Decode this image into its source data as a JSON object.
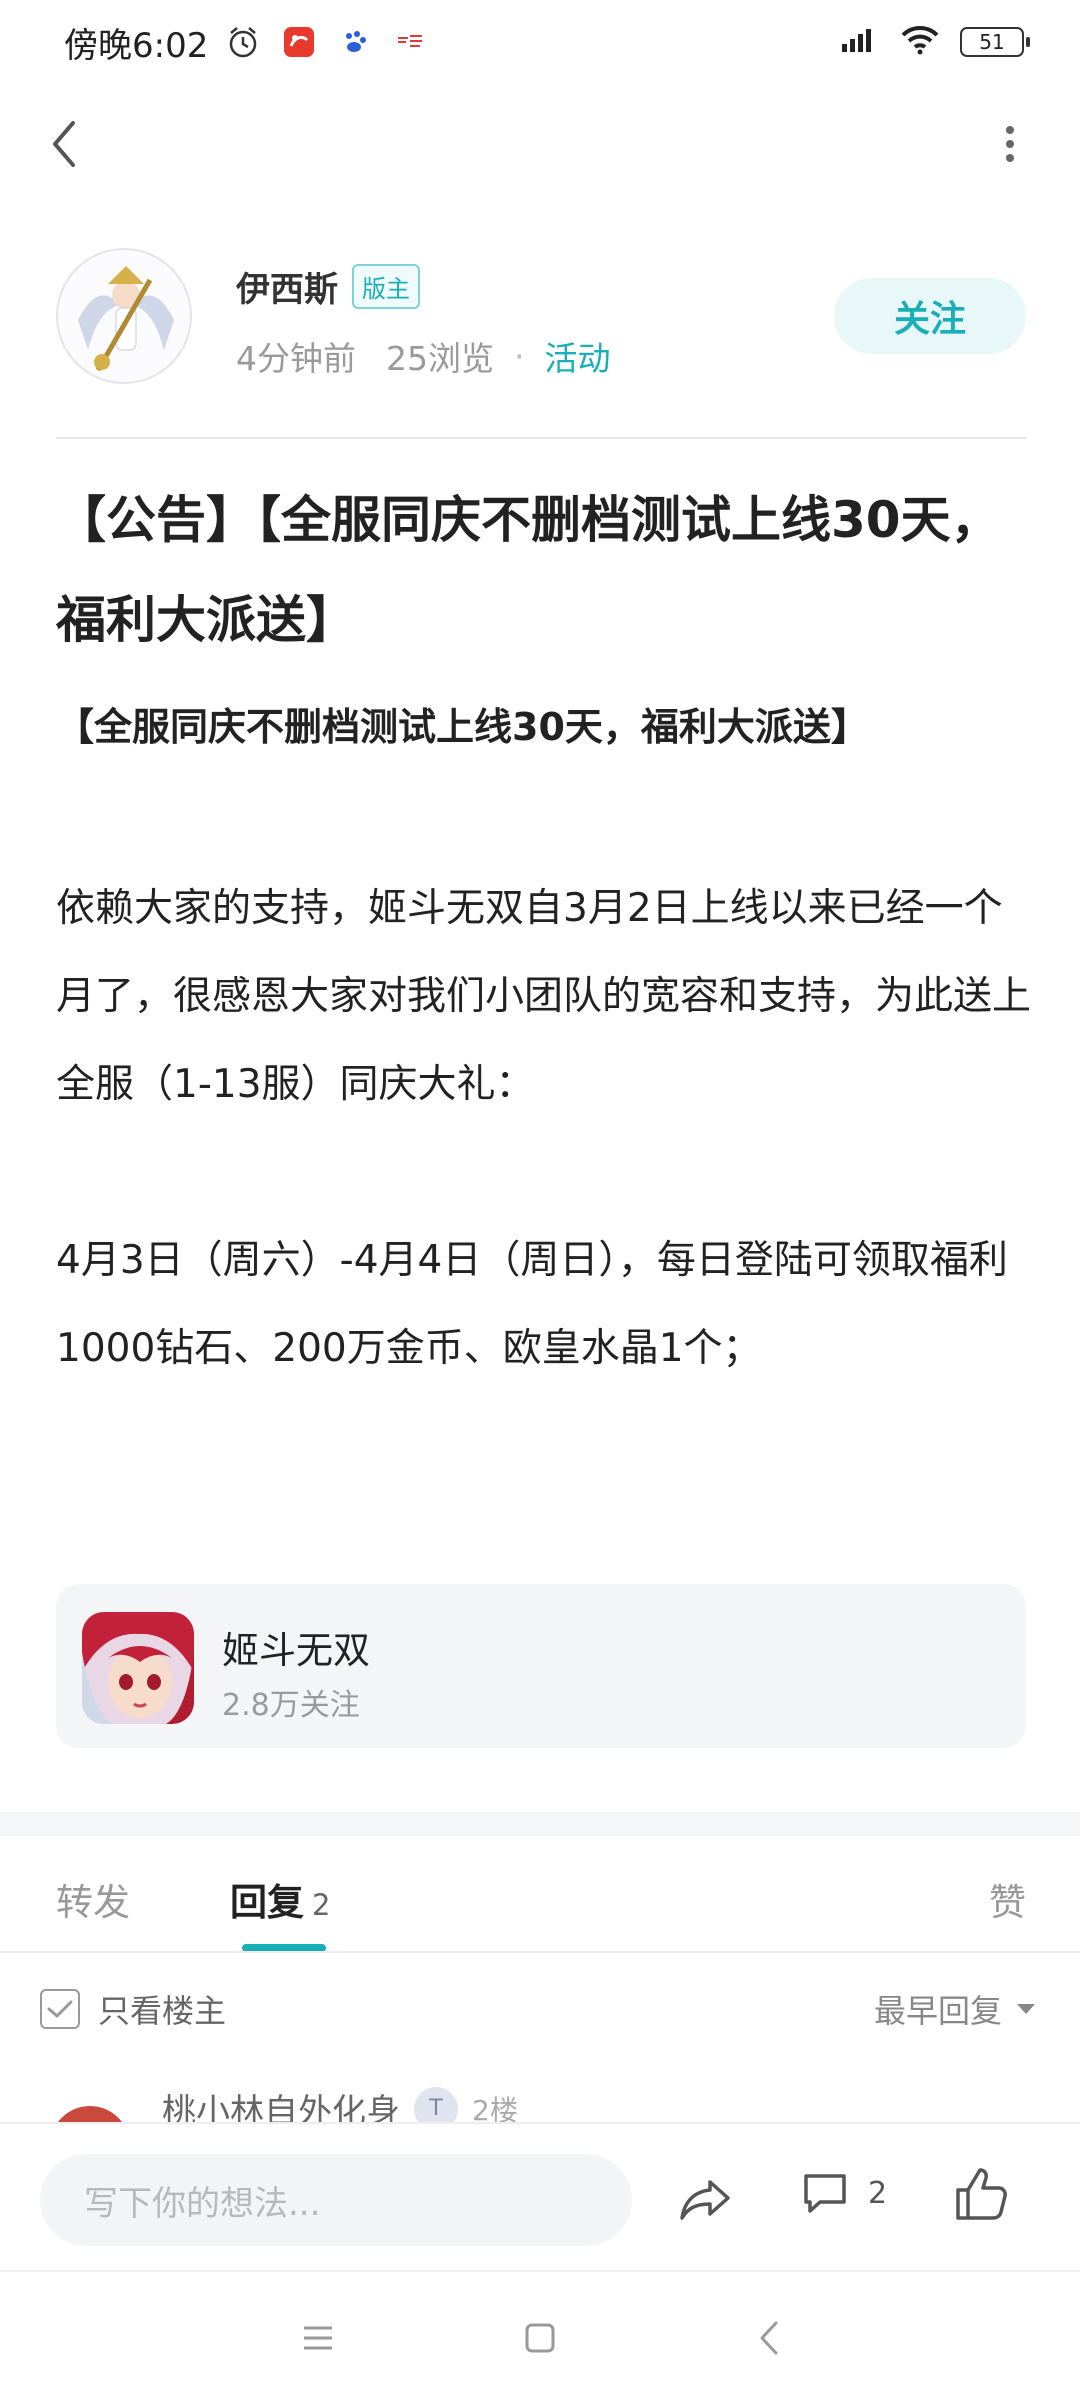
{
  "status_bar": {
    "time": "傍晚6:02",
    "battery": "51",
    "left_icons": [
      "alarm-icon",
      "app-notification-icon",
      "baidu-icon",
      "toutiao-icon"
    ],
    "right_icons": [
      "signal-icon",
      "wifi-icon",
      "battery-icon"
    ]
  },
  "nav": {
    "back_icon": "chevron-left-icon",
    "more_icon": "more-vertical-icon"
  },
  "author": {
    "name": "伊西斯",
    "badge": "版主",
    "time": "4分钟前",
    "views": "25浏览",
    "separator": "·",
    "category": "活动",
    "follow_label": "关注"
  },
  "post": {
    "title": "【公告】【全服同庆不删档测试上线30天，福利大派送】",
    "subtitle": "【全服同庆不删档测试上线30天，福利大派送】",
    "paragraphs": [
      "依赖大家的支持，姬斗无双自3月2日上线以来已经一个月了，很感恩大家对我们小团队的宽容和支持，为此送上全服（1-13服）同庆大礼：",
      "4月3日（周六）-4月4日（周日），每日登陆可领取福利1000钻石、200万金币、欧皇水晶1个；"
    ]
  },
  "game_card": {
    "name": "姬斗无双",
    "followers": "2.8万关注"
  },
  "tabs": {
    "repost": "转发",
    "reply": "回复",
    "reply_count": "2",
    "like": "赞"
  },
  "filter": {
    "owner_only": "只看楼主",
    "sort": "最早回复"
  },
  "comment_preview": {
    "author": "桃小林自外化身",
    "level": "T",
    "floor": "2楼"
  },
  "bottom_bar": {
    "input_placeholder": "写下你的想法...",
    "comment_count": "2"
  },
  "colors": {
    "accent": "#1aaeb8",
    "text_primary": "#222222",
    "text_secondary": "#9a9a9a",
    "card_bg": "#f4f5f7"
  }
}
